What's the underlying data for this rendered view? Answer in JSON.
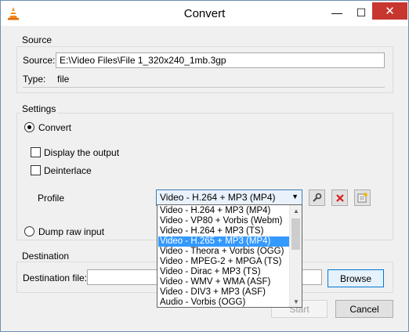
{
  "window": {
    "title": "Convert"
  },
  "source": {
    "group_title": "Source",
    "source_label": "Source:",
    "source_value": "E:\\Video Files\\File 1_320x240_1mb.3gp",
    "type_label": "Type:",
    "type_value": "file"
  },
  "settings": {
    "group_title": "Settings",
    "convert_label": "Convert",
    "display_output_label": "Display the output",
    "deinterlace_label": "Deinterlace",
    "profile_label": "Profile",
    "profile_selected": "Video - H.264 + MP3 (MP4)",
    "profile_options": [
      "Video - H.264 + MP3 (MP4)",
      "Video - VP80 + Vorbis (Webm)",
      "Video - H.264 + MP3 (TS)",
      "Video - H.265 + MP3 (MP4)",
      "Video - Theora + Vorbis (OGG)",
      "Video - MPEG-2 + MPGA (TS)",
      "Video - Dirac + MP3 (TS)",
      "Video - WMV + WMA (ASF)",
      "Video - DIV3 + MP3 (ASF)",
      "Audio - Vorbis (OGG)"
    ],
    "highlighted_option": "Video - H.265 + MP3 (MP4)",
    "dump_raw_label": "Dump raw input"
  },
  "destination": {
    "group_title": "Destination",
    "file_label": "Destination file:",
    "file_value": "",
    "browse_label": "Browse"
  },
  "footer": {
    "start_label": "Start",
    "cancel_label": "Cancel"
  },
  "colors": {
    "selection": "#3399ff",
    "close_button": "#c7372f",
    "delete_icon": "#d9201f"
  }
}
